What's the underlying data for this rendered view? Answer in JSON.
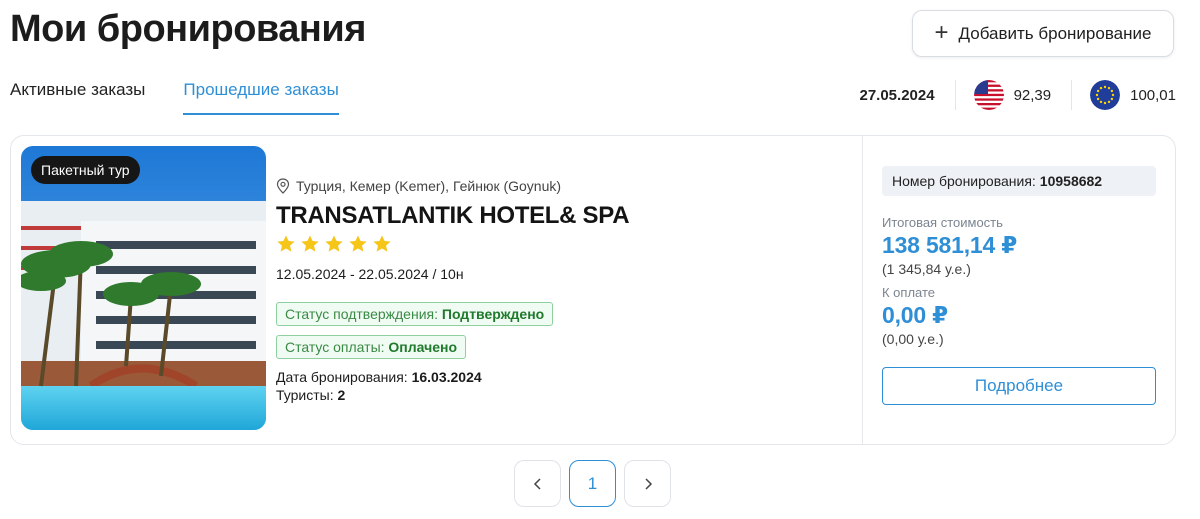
{
  "page": {
    "title": "Мои бронирования"
  },
  "header": {
    "add_button_label": "Добавить бронирование",
    "add_icon": "plus-icon"
  },
  "tabs": [
    {
      "label": "Активные заказы",
      "active": false
    },
    {
      "label": "Прошедшие заказы",
      "active": true
    }
  ],
  "rates": {
    "date": "27.05.2024",
    "items": [
      {
        "currency_flag": "us-flag-icon",
        "value": "92,39"
      },
      {
        "currency_flag": "eu-flag-icon",
        "value": "100,01"
      }
    ]
  },
  "booking": {
    "badge": "Пакетный тур",
    "location": "Турция, Кемер (Kemer), Гейнюк (Goynuk)",
    "hotel_name": "TRANSATLANTIK HOTEL& SPA",
    "stars": 5,
    "dates": "12.05.2024 - 22.05.2024 / 10н",
    "confirmation_status_label": "Статус подтверждения: ",
    "confirmation_status_value": "Подтверждено",
    "payment_status_label": "Статус оплаты: ",
    "payment_status_value": "Оплачено",
    "booking_date_label": "Дата бронирования: ",
    "booking_date_value": "16.03.2024",
    "tourists_label": "Туристы: ",
    "tourists_value": "2",
    "booking_number_label": "Номер бронирования:",
    "booking_number_value": "10958682",
    "total_label": "Итоговая стоимость",
    "total_value": "138 581,14 ₽",
    "total_ue": "(1 345,84 у.е.)",
    "to_pay_label": "К оплате",
    "to_pay_value": "0,00 ₽",
    "to_pay_ue": "(0,00 у.е.)",
    "details_button": "Подробнее"
  },
  "pagination": {
    "current": "1",
    "prev_icon": "chevron-left-icon",
    "next_icon": "chevron-right-icon"
  },
  "colors": {
    "accent": "#2f8fd6",
    "status_green": "#3a8a45",
    "star": "#f5c518"
  }
}
